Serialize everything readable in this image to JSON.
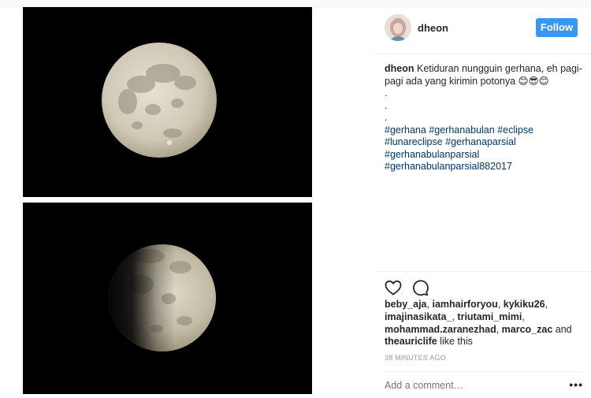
{
  "post": {
    "username": "dheon",
    "follow_label": "Follow",
    "caption": {
      "user": "dheon",
      "text": "Ketiduran nungguin gerhana, eh pagi-pagi ada yang kirimin potonya 😊😎😊",
      "dots": [
        ".",
        ".",
        "."
      ],
      "hashtags": [
        "#gerhana #gerhanabulan #eclipse",
        "#lunareclipse #gerhanaparsial",
        "#gerhanabulanparsial",
        "#gerhanabulanparsial882017"
      ]
    },
    "likers": [
      "beby_aja",
      "iamhairforyou",
      "kykiku26",
      "imajinasikata_",
      "triutami_mimi",
      "mohammad.zaranezhad",
      "marco_zac",
      "theauriclife"
    ],
    "likes_and": "and",
    "likes_suffix": "like this",
    "timestamp": "38 MINUTES AGO",
    "comment_placeholder": "Add a comment…",
    "more_label": "•••"
  },
  "icons": {
    "like": "heart-icon",
    "comment": "speech-bubble-icon",
    "more": "ellipsis-icon"
  },
  "colors": {
    "follow_button": "#3897f0",
    "hashtag": "#003569",
    "moon": "#d6d0bf"
  }
}
